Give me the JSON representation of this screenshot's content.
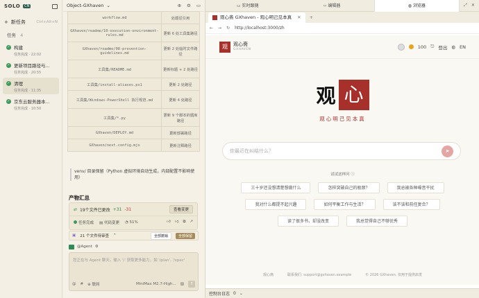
{
  "sidebar": {
    "logo": "SOLO",
    "badge": "CN",
    "new_task": "新任务",
    "new_task_shortcut": "Ctrl+Alt+N",
    "tasks_label": "任务",
    "tasks_count": "4",
    "tasks": [
      {
        "title": "构建",
        "status": "任务完成 · 22:02"
      },
      {
        "title": "更新项目路径与...",
        "status": "任务完成 · 20:55"
      },
      {
        "title": "清理",
        "status": "任务完成 · 11:35"
      },
      {
        "title": "京东云服务器本...",
        "status": "任务完成 · 10:50"
      }
    ]
  },
  "middle": {
    "project": "Object-GXhaven",
    "files": [
      {
        "path": "workflow.md",
        "desc": "处题径引用"
      },
      {
        "path": "GXhaven/readme/10-execution-environment-rules.md",
        "desc": "更新 6 处工具集路径"
      },
      {
        "path": "GXhaven/readme/08-prevention-guidelines.md",
        "desc": "更新 2 处临时文件路径"
      },
      {
        "path": "工具集/README.md",
        "desc": "更新标题 + 2 处路径"
      },
      {
        "path": "工具集/install-aliases.ps1",
        "desc": "更新 2 处路径"
      },
      {
        "path": "工具集/Windows-PowerShell 执行规范.md",
        "desc": "更新 4 处路径"
      },
      {
        "path": "工具集/*.py",
        "desc": "更新 9 个脚本的题库路径"
      },
      {
        "path": "GXhaven/DEPLOY.md",
        "desc": "更新部署路径"
      },
      {
        "path": "GXhaven/next.config.mjs",
        "desc": "更新注释路径"
      }
    ],
    "note": "venv/ 目录保留（Python 虚拟环境自动生成，内部配置不影响使用）",
    "summary_title": "产物汇总",
    "changes": {
      "text": "19个文件已更改",
      "plus": "+31",
      "minus": "-31",
      "view_btn": "查看变更"
    },
    "status": {
      "done": "任务完成",
      "code_changes": "代码变更",
      "percent": "51%"
    },
    "review": {
      "text": "21 个文件待审查",
      "reject": "全部撤销",
      "accept": "全部保留"
    },
    "agent_label": "@Agent",
    "input_placeholder": "您正在与 Agent 聊天。输入 '/' 获取更多能力，如 '/plan', '/spec'",
    "input_bar": {
      "at": "@",
      "hash": "#",
      "web": "⊕ 联网",
      "model": "MiniMax M2.7-High..."
    }
  },
  "browser": {
    "top_tabs": [
      "实时跟随",
      "编辑器",
      "浏览器"
    ],
    "page_tab_title": "观心斋 GXhaven - 观心明己见本真",
    "url": "http://localhost:3000/zh",
    "site": {
      "logo_char": "观",
      "brand_name": "观心斋",
      "brand_en": "GXHAVEN",
      "points": "100",
      "logout": "登出",
      "lang": "EN",
      "hero_char1": "观",
      "hero_char2": "心",
      "motto": "观心明己见本真",
      "ask_placeholder": "你最近在纠结什么？",
      "try_label": "试试这样问",
      "chips": [
        [
          "三十岁还没想清楚想做什么",
          "怎样突破自己的瓶颈？",
          "我总被各种噪音干扰"
        ],
        [
          "我对什么都提不起兴趣",
          "如何平衡工作与生活？",
          "该不该和前任复合？"
        ],
        [
          "读了很多书，却没改变",
          "我总觉得自己不够优秀"
        ]
      ],
      "footer": [
        "观心斋",
        "联系我们: support@gxhaven.example",
        "© 2026 GXhaven. 仅用于提供启发"
      ]
    },
    "console_label": "控制台日志",
    "console_count": "0"
  }
}
